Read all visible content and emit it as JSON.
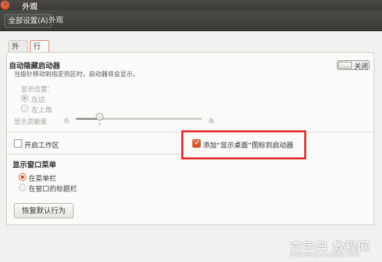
{
  "window": {
    "title": "外观",
    "close_glyph": "✕"
  },
  "toolbar": {
    "all_settings": "全部设置(A)",
    "breadcrumb": "外观"
  },
  "tabs": [
    {
      "label": "外观"
    },
    {
      "label": "行为",
      "active": true
    }
  ],
  "autohide": {
    "title": "自动隐藏启动器",
    "description": "当指针移动到指定热区时，启动器将会显示。",
    "switch_label": "关闭",
    "switch_on": false,
    "position_label": "显示位置：",
    "position_options": [
      {
        "label": "左边",
        "selected": true
      },
      {
        "label": "左上角",
        "selected": false
      }
    ],
    "sensitivity_label": "显示灵敏度",
    "sensitivity_low": "低",
    "sensitivity_high": "高",
    "sensitivity_fraction": 0.19
  },
  "workspaces": {
    "label": "开启工作区",
    "checked": false
  },
  "show_desktop": {
    "label": "添加“显示桌面”图标到启动器",
    "checked": true
  },
  "window_menu": {
    "title": "显示窗口菜单",
    "options": [
      {
        "label": "在菜单栏",
        "selected": true
      },
      {
        "label": "在窗口的标题栏",
        "selected": false
      }
    ]
  },
  "reset_button": "恢复默认行为",
  "checkmark_glyph": "✓",
  "watermark": {
    "text": "查字典 教程网",
    "url": "jiaocheng.chazidian.com"
  },
  "colors": {
    "accent": "#dd4814",
    "highlight_box": "#e6302f",
    "titlebar": "#3c3b37"
  }
}
